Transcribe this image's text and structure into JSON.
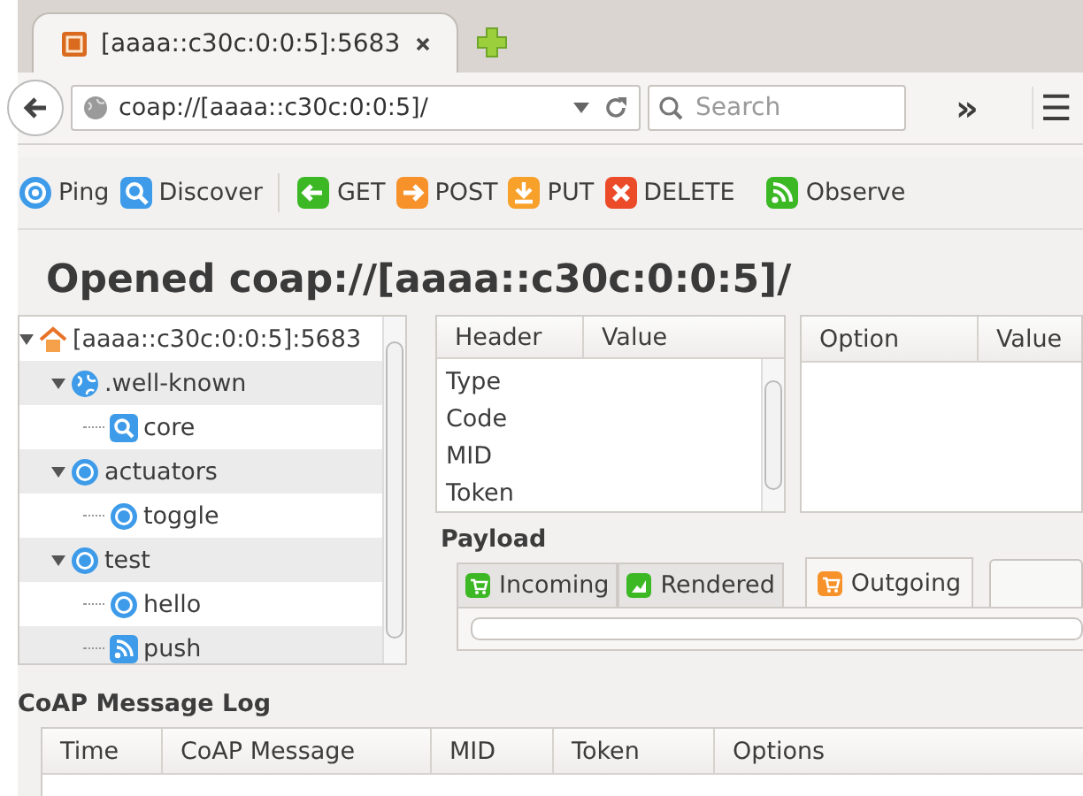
{
  "browser_tab": {
    "title": "[aaaa::c30c:0:0:5]:5683"
  },
  "address_bar": {
    "value": "coap://[aaaa::c30c:0:0:5]/"
  },
  "search": {
    "placeholder": "Search"
  },
  "overflow": "»",
  "menu": "☰",
  "toolbar": [
    {
      "kind": "ping",
      "label": "Ping"
    },
    {
      "kind": "discover",
      "label": "Discover"
    },
    {
      "kind": "separator"
    },
    {
      "kind": "get",
      "label": "GET"
    },
    {
      "kind": "post",
      "label": "POST"
    },
    {
      "kind": "put",
      "label": "PUT"
    },
    {
      "kind": "delete",
      "label": "DELETE"
    },
    {
      "kind": "observe",
      "label": "Observe"
    }
  ],
  "heading": "Opened coap://[aaaa::c30c:0:0:5]/",
  "tree": [
    {
      "kind": "host",
      "label": "[aaaa::c30c:0:0:5]:5683",
      "expanded": true,
      "children": [
        {
          "kind": "folder",
          "label": ".well-known",
          "expanded": true,
          "children": [
            {
              "kind": "discovery",
              "label": "core"
            }
          ]
        },
        {
          "kind": "resource",
          "label": "actuators",
          "expanded": true,
          "children": [
            {
              "kind": "resource",
              "label": "toggle"
            }
          ]
        },
        {
          "kind": "resource",
          "label": "test",
          "expanded": true,
          "children": [
            {
              "kind": "resource",
              "label": "hello"
            },
            {
              "kind": "observable",
              "label": "push"
            }
          ]
        }
      ]
    }
  ],
  "header_table": {
    "columns": [
      "Header",
      "Value"
    ],
    "rows": [
      "Type",
      "Code",
      "MID",
      "Token"
    ]
  },
  "option_table": {
    "columns": [
      "Option",
      "Value"
    ]
  },
  "payload": {
    "label": "Payload",
    "tabs": [
      {
        "label": "Incoming",
        "kind": "incoming",
        "selected": false
      },
      {
        "label": "Rendered",
        "kind": "rendered",
        "selected": false
      },
      {
        "label": "Outgoing",
        "kind": "outgoing",
        "selected": true
      }
    ]
  },
  "log": {
    "title": "CoAP Message Log",
    "columns": [
      "Time",
      "CoAP Message",
      "MID",
      "Token",
      "Options"
    ]
  }
}
